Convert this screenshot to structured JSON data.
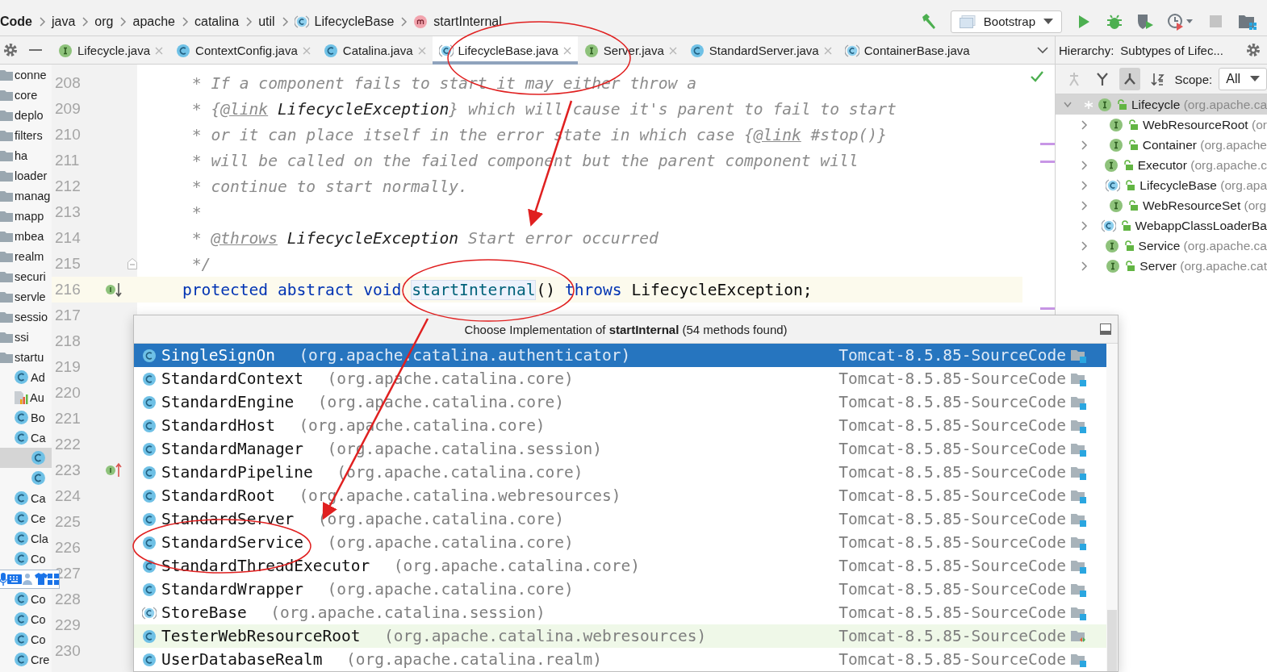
{
  "breadcrumb": [
    {
      "label": "Code",
      "kind": "project"
    },
    {
      "label": "java",
      "kind": "package"
    },
    {
      "label": "org",
      "kind": "package"
    },
    {
      "label": "apache",
      "kind": "package"
    },
    {
      "label": "catalina",
      "kind": "package"
    },
    {
      "label": "util",
      "kind": "package"
    },
    {
      "label": "LifecycleBase",
      "kind": "abstract"
    },
    {
      "label": "startInternal",
      "kind": "method"
    }
  ],
  "run_config": {
    "label": "Bootstrap"
  },
  "tabs": [
    {
      "label": "Lifecycle.java",
      "kind": "interface",
      "selected": false,
      "closable": true
    },
    {
      "label": "ContextConfig.java",
      "kind": "class",
      "selected": false,
      "closable": true
    },
    {
      "label": "Catalina.java",
      "kind": "class",
      "selected": false,
      "closable": true
    },
    {
      "label": "LifecycleBase.java",
      "kind": "abstract",
      "selected": true,
      "closable": true
    },
    {
      "label": "Server.java",
      "kind": "interface",
      "selected": false,
      "closable": true
    },
    {
      "label": "StandardServer.java",
      "kind": "class",
      "selected": false,
      "closable": true
    },
    {
      "label": "ContainerBase.java",
      "kind": "abstract",
      "selected": false,
      "closable": false
    }
  ],
  "project_tree": [
    {
      "label": "conne",
      "kind": "folder"
    },
    {
      "label": "core",
      "kind": "folder"
    },
    {
      "label": "deplo",
      "kind": "folder"
    },
    {
      "label": "filters",
      "kind": "folder"
    },
    {
      "label": "ha",
      "kind": "folder"
    },
    {
      "label": "loader",
      "kind": "folder"
    },
    {
      "label": "manag",
      "kind": "folder"
    },
    {
      "label": "mapp",
      "kind": "folder"
    },
    {
      "label": "mbea",
      "kind": "folder"
    },
    {
      "label": "realm",
      "kind": "folder"
    },
    {
      "label": "securi",
      "kind": "folder"
    },
    {
      "label": "servle",
      "kind": "folder"
    },
    {
      "label": "sessio",
      "kind": "folder"
    },
    {
      "label": "ssi",
      "kind": "folder"
    },
    {
      "label": "startu",
      "kind": "folder",
      "children": [
        {
          "label": "Ad",
          "kind": "class"
        },
        {
          "label": "Au",
          "kind": "file"
        },
        {
          "label": "Bo",
          "kind": "class"
        },
        {
          "label": "Ca",
          "kind": "class",
          "children": [
            {
              "kind": "class",
              "selected": true
            },
            {
              "kind": "class",
              "selected": false
            }
          ]
        },
        {
          "label": "Ca",
          "kind": "class"
        },
        {
          "label": "Ce",
          "kind": "class"
        },
        {
          "label": "Cla",
          "kind": "class"
        },
        {
          "label": "Co",
          "kind": "class"
        },
        {
          "kind": "ime"
        },
        {
          "label": "Co",
          "kind": "class"
        },
        {
          "label": "Co",
          "kind": "class"
        },
        {
          "label": "Co",
          "kind": "class"
        },
        {
          "label": "Cre",
          "kind": "class"
        }
      ]
    }
  ],
  "code_lines": [
    {
      "number": "208",
      "segments": [
        {
          "kind": "comment",
          "text": " * If a component fails to start it may either throw a"
        }
      ]
    },
    {
      "number": "209",
      "segments": [
        {
          "kind": "comment",
          "text": " * {"
        },
        {
          "kind": "tag",
          "text": "@link"
        },
        {
          "kind": "ref",
          "text": " LifecycleException"
        },
        {
          "kind": "comment",
          "text": "} which will cause it's parent to fail to start"
        }
      ]
    },
    {
      "number": "210",
      "segments": [
        {
          "kind": "comment",
          "text": " * or it can place itself in the error state in which case {"
        },
        {
          "kind": "tag",
          "text": "@link"
        },
        {
          "kind": "comment",
          "text": " #stop()}"
        }
      ]
    },
    {
      "number": "211",
      "segments": [
        {
          "kind": "comment",
          "text": " * will be called on the failed component but the parent component will"
        }
      ]
    },
    {
      "number": "212",
      "segments": [
        {
          "kind": "comment",
          "text": " * continue to start normally."
        }
      ]
    },
    {
      "number": "213",
      "segments": [
        {
          "kind": "comment",
          "text": " *"
        }
      ]
    },
    {
      "number": "214",
      "segments": [
        {
          "kind": "comment",
          "text": " * "
        },
        {
          "kind": "tag",
          "text": "@throws"
        },
        {
          "kind": "ref",
          "text": " LifecycleException"
        },
        {
          "kind": "comment",
          "text": " Start error occurred"
        }
      ]
    },
    {
      "number": "215",
      "kind": "fold",
      "segments": [
        {
          "kind": "comment",
          "text": " */"
        }
      ]
    },
    {
      "number": "216",
      "current": true,
      "kind": "implemented",
      "segments": [
        {
          "kind": "keyword",
          "text": "protected abstract void "
        },
        {
          "kind": "method",
          "text": "startInternal"
        },
        {
          "kind": "plain",
          "text": "() "
        },
        {
          "kind": "keyword",
          "text": "throws "
        },
        {
          "kind": "plain",
          "text": "LifecycleException;"
        }
      ]
    },
    {
      "number": "217"
    },
    {
      "number": "218"
    },
    {
      "number": "219"
    },
    {
      "number": "220"
    },
    {
      "number": "221"
    },
    {
      "number": "222"
    },
    {
      "number": "223",
      "kind": "implements"
    },
    {
      "number": "224"
    },
    {
      "number": "225"
    },
    {
      "number": "226"
    },
    {
      "number": "227"
    },
    {
      "number": "228"
    },
    {
      "number": "229"
    },
    {
      "number": "230"
    }
  ],
  "hierarchy": {
    "title": "Hierarchy:",
    "subtitle": "Subtypes of Lifec...",
    "scope_label": "Scope:",
    "scope": "All",
    "tools": [
      {
        "kind": "figure",
        "selected": false
      },
      {
        "kind": "fork",
        "selected": false
      },
      {
        "kind": "tree",
        "selected": true
      },
      {
        "kind": "sort",
        "selected": false
      }
    ],
    "root": {
      "name": "Lifecycle",
      "package": "(org.apache.ca",
      "kind": "interface",
      "expanded": true,
      "selected": true,
      "children": [
        {
          "name": "WebResourceRoot",
          "package": "(or",
          "kind": "interface"
        },
        {
          "name": "Container",
          "package": "(org.apache",
          "kind": "interface"
        },
        {
          "name": "Executor",
          "package": "(org.apache.c",
          "kind": "interface"
        },
        {
          "name": "LifecycleBase",
          "package": "(org.apa",
          "kind": "abstract"
        },
        {
          "name": "WebResourceSet",
          "package": "(org",
          "kind": "interface"
        },
        {
          "name": "WebappClassLoaderBa",
          "kind": "abstract"
        },
        {
          "name": "Service",
          "package": "(org.apache.ca",
          "kind": "interface"
        },
        {
          "name": "Server",
          "package": "(org.apache.cat",
          "kind": "interface"
        }
      ]
    }
  },
  "popup": {
    "title_prefix": "Choose Implementation of ",
    "title_method": "startInternal",
    "title_suffix": " (54 methods found)",
    "rows": [
      {
        "name": "SingleSignOn",
        "package": "(org.apache.catalina.authenticator)",
        "module": "Tomcat-8.5.85-SourceCode",
        "kind": "class",
        "selected": true,
        "test": false
      },
      {
        "name": "StandardContext",
        "package": "(org.apache.catalina.core)",
        "module": "Tomcat-8.5.85-SourceCode",
        "kind": "class",
        "selected": false,
        "test": false
      },
      {
        "name": "StandardEngine",
        "package": "(org.apache.catalina.core)",
        "module": "Tomcat-8.5.85-SourceCode",
        "kind": "class",
        "selected": false,
        "test": false
      },
      {
        "name": "StandardHost",
        "package": "(org.apache.catalina.core)",
        "module": "Tomcat-8.5.85-SourceCode",
        "kind": "class",
        "selected": false,
        "test": false
      },
      {
        "name": "StandardManager",
        "package": "(org.apache.catalina.session)",
        "module": "Tomcat-8.5.85-SourceCode",
        "kind": "class",
        "selected": false,
        "test": false
      },
      {
        "name": "StandardPipeline",
        "package": "(org.apache.catalina.core)",
        "module": "Tomcat-8.5.85-SourceCode",
        "kind": "class",
        "selected": false,
        "test": false
      },
      {
        "name": "StandardRoot",
        "package": "(org.apache.catalina.webresources)",
        "module": "Tomcat-8.5.85-SourceCode",
        "kind": "class",
        "selected": false,
        "test": false
      },
      {
        "name": "StandardServer",
        "package": "(org.apache.catalina.core)",
        "module": "Tomcat-8.5.85-SourceCode",
        "kind": "class",
        "selected": false,
        "test": false
      },
      {
        "name": "StandardService",
        "package": "(org.apache.catalina.core)",
        "module": "Tomcat-8.5.85-SourceCode",
        "kind": "class",
        "selected": false,
        "test": false
      },
      {
        "name": "StandardThreadExecutor",
        "package": "(org.apache.catalina.core)",
        "module": "Tomcat-8.5.85-SourceCode",
        "kind": "class",
        "selected": false,
        "test": false
      },
      {
        "name": "StandardWrapper",
        "package": "(org.apache.catalina.core)",
        "module": "Tomcat-8.5.85-SourceCode",
        "kind": "class",
        "selected": false,
        "test": false
      },
      {
        "name": "StoreBase",
        "package": "(org.apache.catalina.session)",
        "module": "Tomcat-8.5.85-SourceCode",
        "kind": "abstract",
        "selected": false,
        "test": false
      },
      {
        "name": "TesterWebResourceRoot",
        "package": "(org.apache.catalina.webresources)",
        "module": "Tomcat-8.5.85-SourceCode",
        "kind": "class",
        "selected": false,
        "test": true
      },
      {
        "name": "UserDatabaseRealm",
        "package": "(org.apache.catalina.realm)",
        "module": "Tomcat-8.5.85-SourceCode",
        "kind": "class",
        "selected": false,
        "test": false
      }
    ]
  }
}
